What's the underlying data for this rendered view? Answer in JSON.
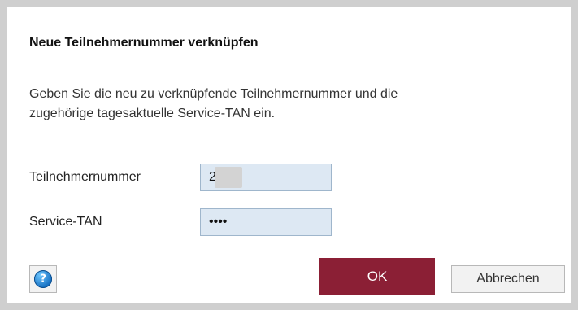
{
  "dialog": {
    "title": "Neue Teilnehmernummer verknüpfen",
    "description_line1": "Geben Sie die neu zu verknüpfende Teilnehmernummer und die",
    "description_line2": "zugehörige tagesaktuelle Service-TAN ein."
  },
  "form": {
    "participant_label": "Teilnehmernummer",
    "participant_value": "2     2",
    "tan_label": "Service-TAN",
    "tan_value": "••••"
  },
  "buttons": {
    "help_icon": "question-mark",
    "help_glyph": "?",
    "ok_label": "OK",
    "cancel_label": "Abbrechen"
  },
  "colors": {
    "ok_background": "#8b1f35",
    "field_background": "#dde8f3",
    "help_icon": "#1670c2"
  }
}
